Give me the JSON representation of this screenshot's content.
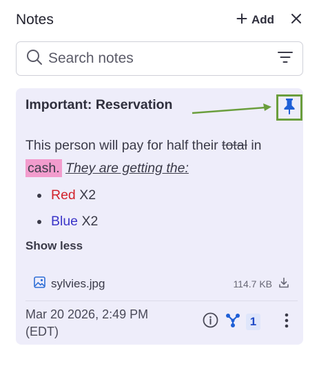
{
  "panel": {
    "title": "Notes",
    "add_label": "Add"
  },
  "search": {
    "placeholder": "Search notes"
  },
  "note": {
    "title": "Important: Reservation",
    "body": {
      "p1": "This person will pay for half their",
      "strike": "total",
      "p2": "in",
      "highlight": "cash.",
      "italic": "They are getting the:"
    },
    "list": [
      {
        "colored": "Red",
        "rest": "X2",
        "color": "#d2222b"
      },
      {
        "colored": "Blue",
        "rest": "X2",
        "color": "#3b35c8"
      }
    ],
    "show_less": "Show less",
    "attachment": {
      "name": "sylvies.jpg",
      "size": "114.7 KB"
    },
    "timestamp_line1": "Mar 20 2026, 2:49 PM",
    "timestamp_line2": "(EDT)",
    "link_count": "1"
  },
  "colors": {
    "card_bg": "#eeedfa",
    "accent_blue": "#1f5fd6",
    "annotation_green": "#6a9e3c",
    "highlight_pink": "#f29ccd"
  },
  "icons": [
    "plus-icon",
    "close-icon",
    "search-icon",
    "filter-icon",
    "pin-icon",
    "image-icon",
    "download-icon",
    "info-icon",
    "link-icon",
    "more-vertical-icon"
  ]
}
